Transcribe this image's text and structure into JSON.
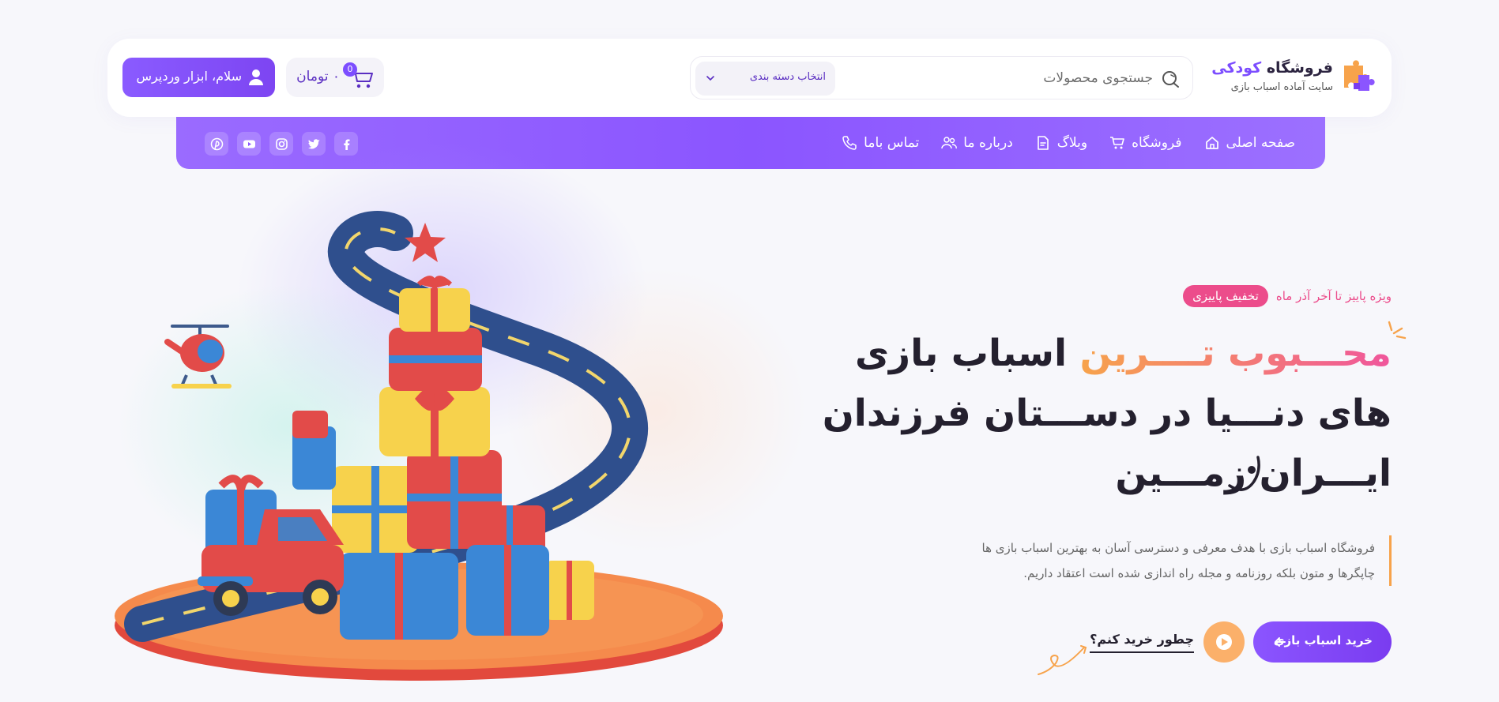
{
  "header": {
    "logo": {
      "title_main": "فروشگاه",
      "title_accent": "کودکی",
      "subtitle": "سایت آماده اسباب بازی"
    },
    "search": {
      "placeholder": "جستجوی محصولات",
      "category_label": "انتخاب دسته بندی"
    },
    "cart": {
      "count": "0",
      "total": "۰ تومان"
    },
    "account": {
      "label": "سلام، ابزار وردپرس"
    }
  },
  "nav": {
    "items": [
      {
        "label": "صفحه اصلی",
        "icon": "home-icon"
      },
      {
        "label": "فروشگاه",
        "icon": "cart-icon"
      },
      {
        "label": "وبلاگ",
        "icon": "document-icon"
      },
      {
        "label": "درباره ما",
        "icon": "users-icon"
      },
      {
        "label": "تماس باما",
        "icon": "phone-icon"
      }
    ],
    "social": [
      "facebook-icon",
      "twitter-icon",
      "instagram-icon",
      "youtube-icon",
      "pinterest-icon"
    ]
  },
  "hero": {
    "promo_badge": "تخفیف پاییزی",
    "promo_text": "ویژه پاییز تا آخر آذر ماه",
    "headline_accent": "محـــبوب تــــرین",
    "headline_1_rest": "اسباب بازی",
    "headline_2": "های دنـــیا در دســـتان فرزندان",
    "headline_3": "ایـــران زمـــین",
    "description_1": "فروشگاه اسباب بازی با هدف معرفی و دسترسی آسان به بهترین اسباب بازی ها",
    "description_2": "چاپگرها و متون بلکه روزنامه و مجله راه اندازی شده است اعتقاد داریم.",
    "buy_button": "خرید اسباب بازی",
    "how_link": "چطور خرید کنم؟"
  },
  "colors": {
    "brand_purple": "#8b55ff",
    "accent_pink": "#ec4c8b",
    "accent_orange": "#f7a34b",
    "background": "#f7f7fb"
  }
}
